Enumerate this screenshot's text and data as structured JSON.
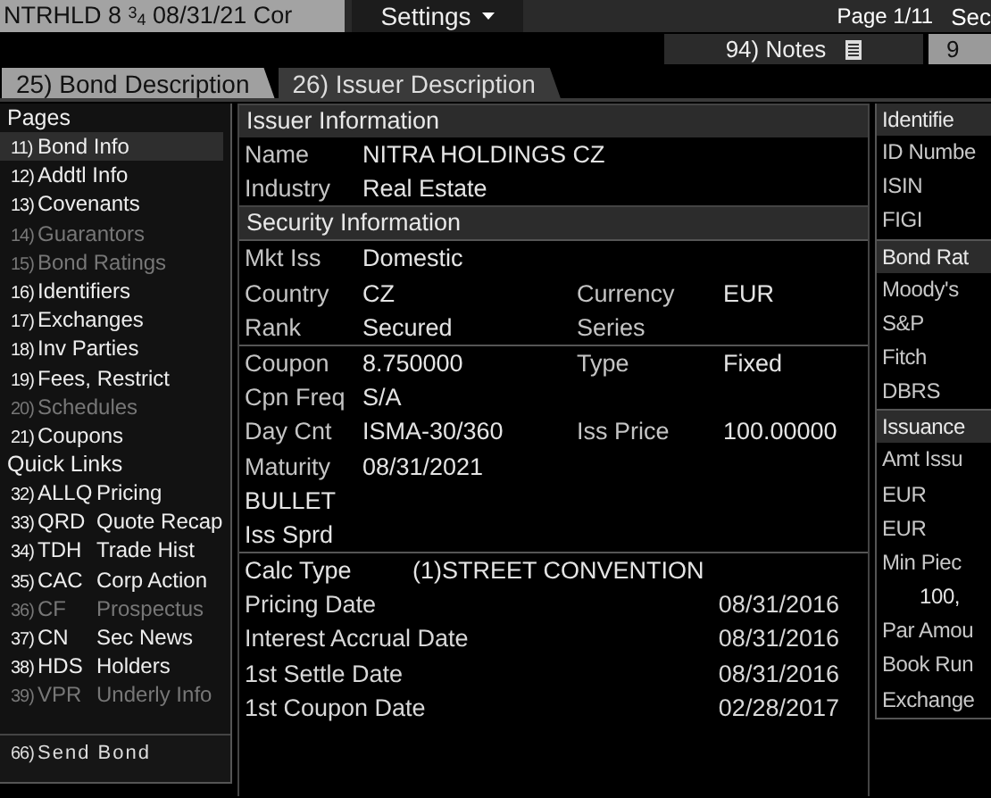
{
  "ticker": "NTRHLD 8 $^{3}$$_{4}$ 08/31/21 Cor",
  "settings_menu": {
    "label": "Settings"
  },
  "page_indicator": "Page 1/11",
  "top_right_cut": "Sec",
  "toolbar_buttons": [
    {
      "label": "94) Notes",
      "kind": "notes"
    },
    {
      "label": "9",
      "kind": "plain"
    }
  ],
  "tabs": [
    {
      "label": "25) Bond Description",
      "selected": true
    },
    {
      "label": "26) Issuer Description",
      "selected": false
    }
  ],
  "sidebar": {
    "pages_title": "Pages",
    "pages": [
      {
        "number": "11)",
        "label": "Bond Info",
        "selected": true,
        "disabled": false
      },
      {
        "number": "12)",
        "label": "Addtl Info",
        "selected": false,
        "disabled": false
      },
      {
        "number": "13)",
        "label": "Covenants",
        "selected": false,
        "disabled": false
      },
      {
        "number": "14)",
        "label": "Guarantors",
        "selected": false,
        "disabled": true
      },
      {
        "number": "15)",
        "label": "Bond Ratings",
        "selected": false,
        "disabled": true
      },
      {
        "number": "16)",
        "label": "Identifiers",
        "selected": false,
        "disabled": false
      },
      {
        "number": "17)",
        "label": "Exchanges",
        "selected": false,
        "disabled": false
      },
      {
        "number": "18)",
        "label": "Inv Parties",
        "selected": false,
        "disabled": false
      },
      {
        "number": "19)",
        "label": "Fees, Restrict",
        "selected": false,
        "disabled": false
      },
      {
        "number": "20)",
        "label": "Schedules",
        "selected": false,
        "disabled": true
      },
      {
        "number": "21)",
        "label": "Coupons",
        "selected": false,
        "disabled": false
      }
    ],
    "quick_links_title": "Quick Links",
    "quick_links": [
      {
        "number": "32)",
        "code": "ALLQ",
        "label": "Pricing",
        "disabled": false
      },
      {
        "number": "33)",
        "code": "QRD",
        "label": "Quote Recap",
        "disabled": false
      },
      {
        "number": "34)",
        "code": "TDH",
        "label": "Trade Hist",
        "disabled": false
      },
      {
        "number": "35)",
        "code": "CAC",
        "label": "Corp Action",
        "disabled": false
      },
      {
        "number": "36)",
        "code": "CF",
        "label": "Prospectus",
        "disabled": true
      },
      {
        "number": "37)",
        "code": "CN",
        "label": "Sec News",
        "disabled": false
      },
      {
        "number": "38)",
        "code": "HDS",
        "label": "Holders",
        "disabled": false
      },
      {
        "number": "39)",
        "code": "VPR",
        "label": "Underly Info",
        "disabled": true
      }
    ],
    "send_bond": {
      "number": "66)",
      "label": "Send Bond"
    }
  },
  "issuer_information": {
    "title": "Issuer Information",
    "fields": [
      {
        "label": "Name",
        "value": "NITRA HOLDINGS CZ"
      },
      {
        "label": "Industry",
        "value": "Real Estate"
      }
    ]
  },
  "security_information": {
    "title": "Security Information",
    "groups": [
      [
        {
          "label": "Mkt Iss",
          "value": "Domestic"
        },
        {
          "label": "Country",
          "value": "CZ",
          "label_2": "Currency",
          "value_2": "EUR"
        },
        {
          "label": "Rank",
          "value": "Secured",
          "label_2": "Series"
        }
      ],
      [
        {
          "label": "Coupon",
          "value": "8.750000",
          "label_2": "Type",
          "value_2": "Fixed"
        },
        {
          "label": "Cpn Freq",
          "value": "S/A"
        },
        {
          "label": "Day Cnt",
          "value": "ISMA-30/360",
          "label_2": "Iss Price",
          "value_2": "100.00000"
        },
        {
          "label": "Maturity",
          "value": "08/31/2021"
        },
        {
          "label": "BULLET"
        },
        {
          "label": "Iss Sprd"
        }
      ]
    ],
    "calc_type": {
      "label": "Calc Type",
      "value": "(1)STREET CONVENTION"
    },
    "dates": [
      {
        "label": "Pricing Date",
        "value": "08/31/2016"
      },
      {
        "label": "Interest Accrual Date",
        "value": "08/31/2016"
      },
      {
        "label": "1st Settle Date",
        "value": "08/31/2016"
      },
      {
        "label": "1st Coupon Date",
        "value": "02/28/2017"
      }
    ]
  },
  "right_panel": [
    {
      "title": "Identifie",
      "rows": [
        {
          "text": "ID Numbe",
          "indented": false
        },
        {
          "text": "ISIN",
          "indented": false
        },
        {
          "text": "FIGI",
          "indented": false
        }
      ]
    },
    {
      "title": "Bond Rat",
      "rows": [
        {
          "text": "Moody's",
          "indented": false
        },
        {
          "text": "S&P",
          "indented": false
        },
        {
          "text": "Fitch",
          "indented": false
        },
        {
          "text": "DBRS",
          "indented": false
        }
      ]
    },
    {
      "title": "Issuance",
      "rows": [
        {
          "text": "Amt Issu",
          "indented": false
        },
        {
          "text": "EUR",
          "indented": false
        },
        {
          "text": "EUR",
          "indented": false
        },
        {
          "text": "Min Piec",
          "indented": false
        },
        {
          "text": "100,",
          "indented": true
        },
        {
          "text": "Par Amou",
          "indented": false
        },
        {
          "text": "Book Run",
          "indented": false
        },
        {
          "text": "Exchange",
          "indented": false
        }
      ]
    }
  ]
}
